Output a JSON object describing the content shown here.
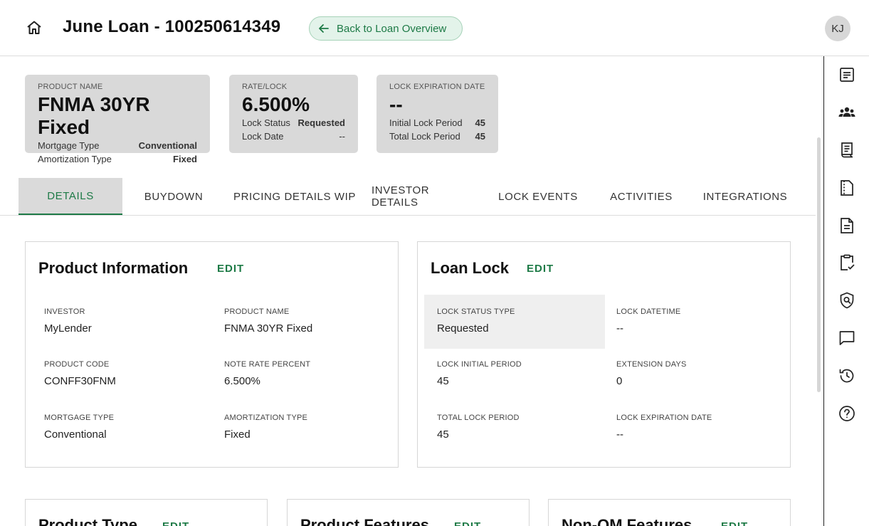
{
  "header": {
    "title": "June Loan - 100250614349",
    "back_label": "Back to Loan Overview",
    "avatar_initials": "KJ"
  },
  "summary": {
    "product": {
      "label": "PRODUCT NAME",
      "value": "FNMA 30YR Fixed",
      "row1_label": "Mortgage Type",
      "row1_value": "Conventional",
      "row2_label": "Amortization Type",
      "row2_value": "Fixed"
    },
    "rate": {
      "label": "RATE/LOCK",
      "value": "6.500%",
      "row1_label": "Lock Status",
      "row1_value": "Requested",
      "row2_label": "Lock Date",
      "row2_value": "--"
    },
    "lock": {
      "label": "LOCK EXPIRATION DATE",
      "value": "--",
      "row1_label": "Initial Lock Period",
      "row1_value": "45",
      "row2_label": "Total Lock Period",
      "row2_value": "45"
    }
  },
  "tabs": [
    "DETAILS",
    "BUYDOWN",
    "PRICING DETAILS WIP",
    "INVESTOR DETAILS",
    "LOCK EVENTS",
    "ACTIVITIES",
    "INTEGRATIONS"
  ],
  "product_info": {
    "title": "Product Information",
    "edit": "EDIT",
    "fields": [
      {
        "label": "INVESTOR",
        "value": "MyLender"
      },
      {
        "label": "PRODUCT NAME",
        "value": "FNMA 30YR Fixed"
      },
      {
        "label": "PRODUCT CODE",
        "value": "CONFF30FNM"
      },
      {
        "label": "NOTE RATE PERCENT",
        "value": "6.500%"
      },
      {
        "label": "MORTGAGE TYPE",
        "value": "Conventional"
      },
      {
        "label": "AMORTIZATION TYPE",
        "value": "Fixed"
      }
    ]
  },
  "loan_lock": {
    "title": "Loan Lock",
    "edit": "EDIT",
    "fields": [
      {
        "label": "LOCK STATUS TYPE",
        "value": "Requested"
      },
      {
        "label": "LOCK DATETIME",
        "value": "--"
      },
      {
        "label": "LOCK INITIAL PERIOD",
        "value": "45"
      },
      {
        "label": "EXTENSION DAYS",
        "value": "0"
      },
      {
        "label": "TOTAL LOCK PERIOD",
        "value": "45"
      },
      {
        "label": "LOCK EXPIRATION DATE",
        "value": "--"
      }
    ]
  },
  "bottom_panels": [
    {
      "title": "Product Type",
      "edit": "EDIT"
    },
    {
      "title": "Product Features",
      "edit": "EDIT"
    },
    {
      "title": "Non-QM Features",
      "edit": "EDIT"
    }
  ],
  "rail_icons": [
    "checklist-icon",
    "people-icon",
    "receipt-icon",
    "document-dashed-icon",
    "document-icon",
    "clipboard-check-icon",
    "shield-search-icon",
    "chat-icon",
    "history-icon",
    "help-icon"
  ]
}
